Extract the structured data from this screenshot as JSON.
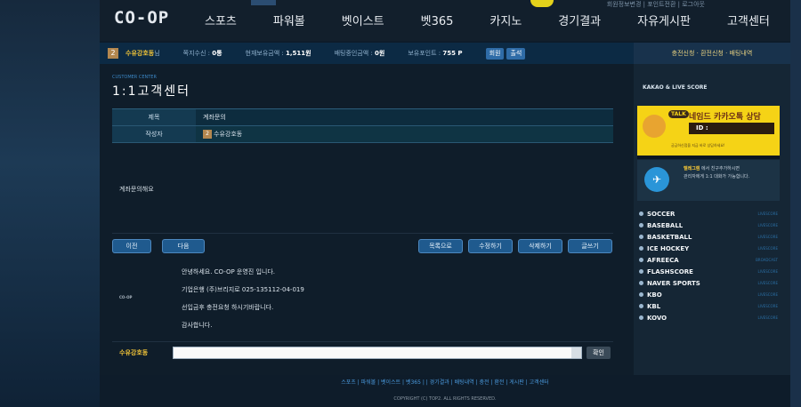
{
  "header": {
    "logo": "CO-OP",
    "nav": [
      "스포츠",
      "파워볼",
      "벳이스트",
      "벳365",
      "카지노",
      "경기결과",
      "자유게시판",
      "고객센터"
    ],
    "top_links": "회원정보변경 | 포인트전환 | 로그아웃"
  },
  "infobar": {
    "level": "2",
    "nickname": "수유강호동",
    "nickname_suffix": "님",
    "items": [
      {
        "label": "쪽지수신 : ",
        "value": "0통"
      },
      {
        "label": "현재보유금액 : ",
        "value": "1,511원"
      },
      {
        "label": "배팅중인금액 : ",
        "value": "0원"
      },
      {
        "label": "보유포인트 : ",
        "value": "755 P"
      }
    ],
    "btn_check": "회원",
    "btn_attend": "출석"
  },
  "side_top": "충전신청  ·  환전신청  ·  배팅내역",
  "main": {
    "cs_en": "CUSTOMER CENTER",
    "cs_title": "1:1고객센터",
    "subject_label": "제목",
    "subject_value": "계좌문의",
    "author_label": "작성자",
    "author_level": "2",
    "author_value": "수유강호동",
    "content": "계좌문의해요",
    "btn_prev": "이전",
    "btn_next": "다음",
    "btn_list": "목록으로",
    "btn_edit": "수정하기",
    "btn_delete": "삭제하기",
    "btn_write": "글쓰기",
    "sig_logo": "CO-OP",
    "signature": [
      "안녕하세요. CO-OP 운영진 입니다.",
      "기업은행 (주)브리지로 025-135112-04-019",
      "선입금후 충전요청 하시기바랍니다.",
      "감사합니다."
    ],
    "comment_nick": "수유강호동",
    "comment_btn": "확인"
  },
  "sidebar": {
    "title": "KAKAO & LIVE SCORE",
    "kakao_talk": "TALK",
    "kakao_title": "네임드 카카오톡 상담",
    "kakao_id": "ID :",
    "kakao_note": "궁금하신점을 지금 바로 상담하세요!",
    "telegram_name": "텔레그램",
    "telegram_line1": " 에서 친구추가하시면",
    "telegram_line2": "관리자에게 1:1 대화가 가능합니다.",
    "sports": [
      {
        "name": "SOCCER",
        "live": "LIVESCORE"
      },
      {
        "name": "BASEBALL",
        "live": "LIVESCORE"
      },
      {
        "name": "BASKETBALL",
        "live": "LIVESCORE"
      },
      {
        "name": "ICE HOCKEY",
        "live": "LIVESCORE"
      },
      {
        "name": "AFREECA",
        "live": "BROADCAST"
      },
      {
        "name": "FLASHSCORE",
        "live": "LIVESCORE"
      },
      {
        "name": "NAVER SPORTS",
        "live": "LIVESCORE"
      },
      {
        "name": "KBO",
        "live": "LIVESCORE"
      },
      {
        "name": "KBL",
        "live": "LIVESCORE"
      },
      {
        "name": "KOVO",
        "live": "LIVESCORE"
      }
    ]
  },
  "footer": {
    "links": "스포츠  |  파워볼  |  벳이스트  |  벳365  |    |  경기결과  |  배팅내역  |  충전  |  환전  |  게시판  |  고객센터",
    "copyright": "COPYRIGHT (C) TOP2. ALL RIGHTS RESERVED."
  }
}
